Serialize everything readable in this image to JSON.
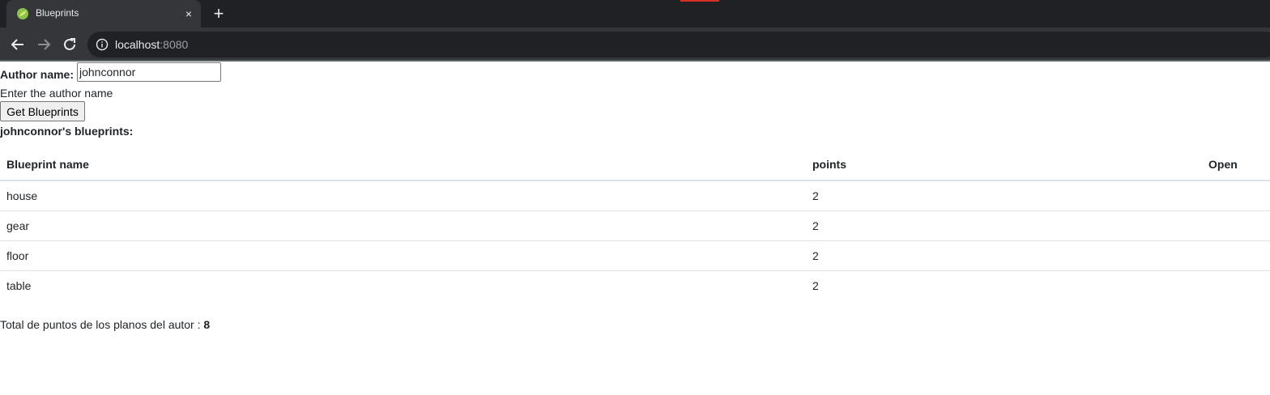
{
  "browser": {
    "tab_title": "Blueprints",
    "tab_close": "×",
    "new_tab": "+",
    "url_host": "localhost",
    "url_port": ":8080"
  },
  "form": {
    "author_label": "Author name:",
    "author_value": "johnconnor",
    "hint": "Enter the author name",
    "button_label": "Get Blueprints"
  },
  "blueprints_title": "johnconnor's blueprints:",
  "table": {
    "headers": [
      "Blueprint name",
      "points",
      "Open"
    ],
    "rows": [
      {
        "name": "house",
        "points": "2",
        "open": ""
      },
      {
        "name": "gear",
        "points": "2",
        "open": ""
      },
      {
        "name": "floor",
        "points": "2",
        "open": ""
      },
      {
        "name": "table",
        "points": "2",
        "open": ""
      }
    ]
  },
  "total": {
    "label": "Total de puntos de los planos del autor : ",
    "value": "8"
  }
}
